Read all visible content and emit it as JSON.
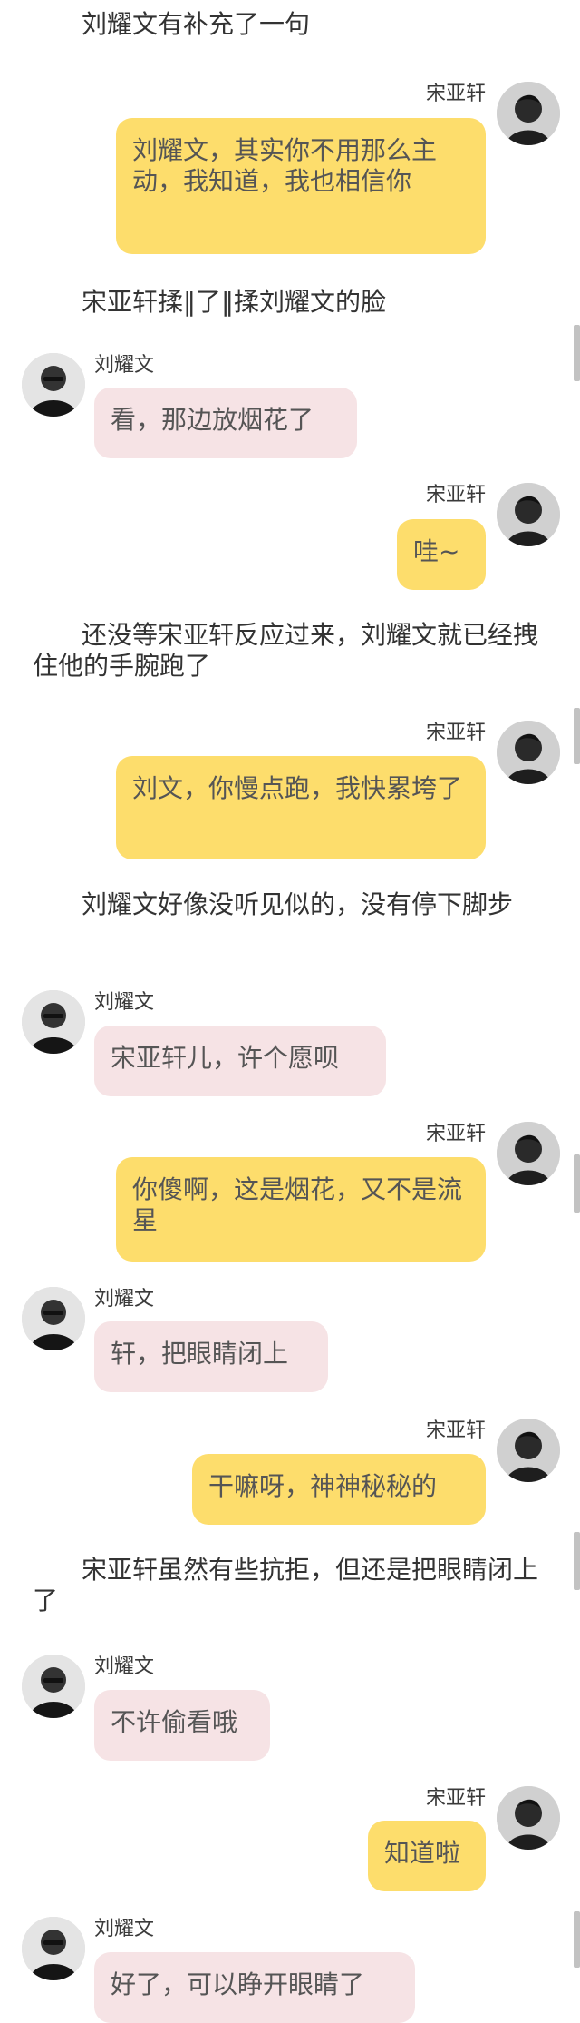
{
  "conversation": {
    "speakers": {
      "right": "宋亚轩",
      "left": "刘耀文"
    },
    "narration": [
      "刘耀文有补充了一句",
      "宋亚轩揉‖了‖揉刘耀文的脸",
      "还没等宋亚轩反应过来，刘耀文就已经拽住他的手腕跑了",
      "刘耀文好像没听见似的，没有停下脚步",
      "宋亚轩虽然有些抗拒，但还是把眼睛闭上了"
    ],
    "messages": [
      {
        "side": "right",
        "name": "宋亚轩",
        "text": "刘耀文，其实你不用那么主动，我知道，我也相信你"
      },
      {
        "side": "left",
        "name": "刘耀文",
        "text": "看，那边放烟花了"
      },
      {
        "side": "right",
        "name": "宋亚轩",
        "text": "哇~"
      },
      {
        "side": "right",
        "name": "宋亚轩",
        "text": "刘文，你慢点跑，我快累垮了"
      },
      {
        "side": "left",
        "name": "刘耀文",
        "text": "宋亚轩儿，许个愿呗"
      },
      {
        "side": "right",
        "name": "宋亚轩",
        "text": "你傻啊，这是烟花，又不是流星"
      },
      {
        "side": "left",
        "name": "刘耀文",
        "text": "轩，把眼睛闭上"
      },
      {
        "side": "right",
        "name": "宋亚轩",
        "text": "干嘛呀，神神秘秘的"
      },
      {
        "side": "left",
        "name": "刘耀文",
        "text": "不许偷看哦"
      },
      {
        "side": "right",
        "name": "宋亚轩",
        "text": "知道啦"
      },
      {
        "side": "left",
        "name": "刘耀文",
        "text": "好了，可以睁开眼睛了"
      }
    ]
  },
  "colors": {
    "right_bubble": "#fddd6c",
    "left_bubble": "#f6e3e5",
    "background": "#ffffff"
  },
  "icons": {
    "right_avatar": "avatar-songyaxuan-icon",
    "left_avatar": "avatar-liuyaowen-icon"
  }
}
